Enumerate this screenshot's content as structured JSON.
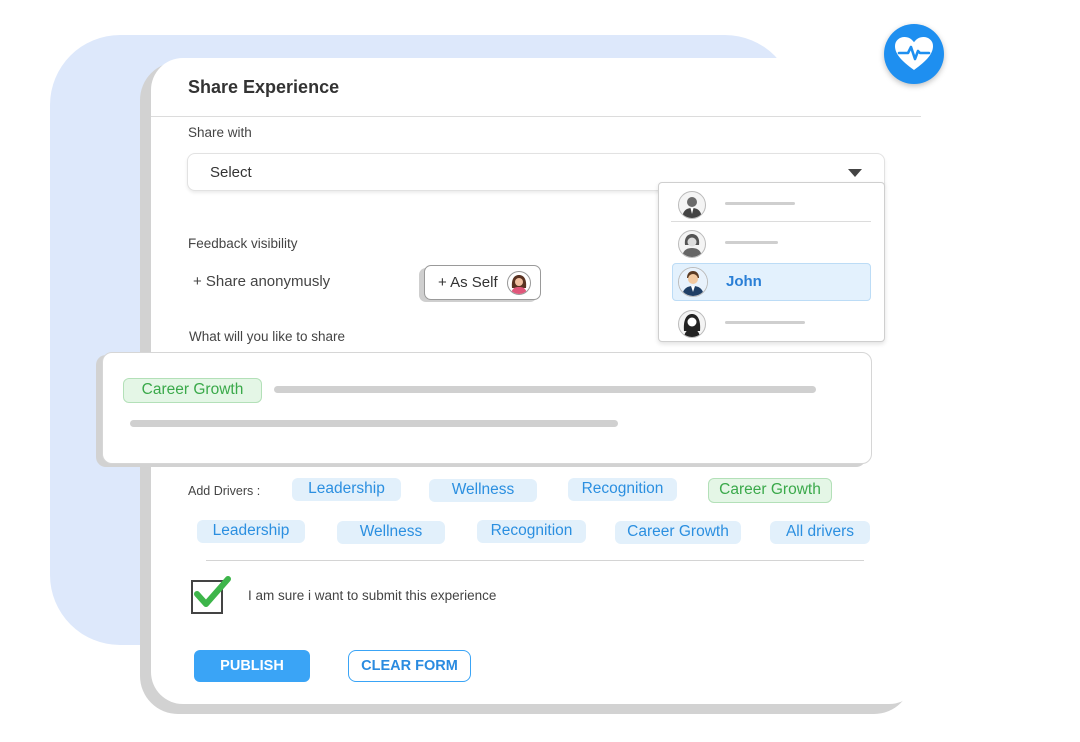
{
  "dialog": {
    "title": "Share Experience"
  },
  "share_with": {
    "label": "Share with",
    "select_value": "Select",
    "options": [
      {
        "label": "",
        "icon": "male-user-icon"
      },
      {
        "label": "",
        "icon": "female-user-icon"
      },
      {
        "label": "John",
        "icon": "user-avatar-icon",
        "selected": true
      },
      {
        "label": "",
        "icon": "female-user-icon"
      }
    ]
  },
  "visibility": {
    "label": "Feedback visibility",
    "anonymous_label": "+ Share anonymusly",
    "self_label": "+ As Self"
  },
  "share_content": {
    "label": "What will you like to share",
    "tag": "Career Growth"
  },
  "drivers": {
    "label": "Add Drivers :",
    "row1": [
      "Leadership",
      "Wellness",
      "Recognition",
      "Career Growth"
    ],
    "row2": [
      "Leadership",
      "Wellness",
      "Recognition",
      "Career Growth",
      "All drivers"
    ]
  },
  "confirm": {
    "label": "I am sure i want to submit this experience",
    "checked": true
  },
  "actions": {
    "publish": "PUBLISH",
    "clear": "CLEAR FORM"
  },
  "colors": {
    "accent": "#3aa4f6",
    "badge": "#1e8ff0",
    "green_tag": "#3aa94a",
    "blue_tag": "#2b8fe0",
    "background_blob": "#dde8fb"
  }
}
